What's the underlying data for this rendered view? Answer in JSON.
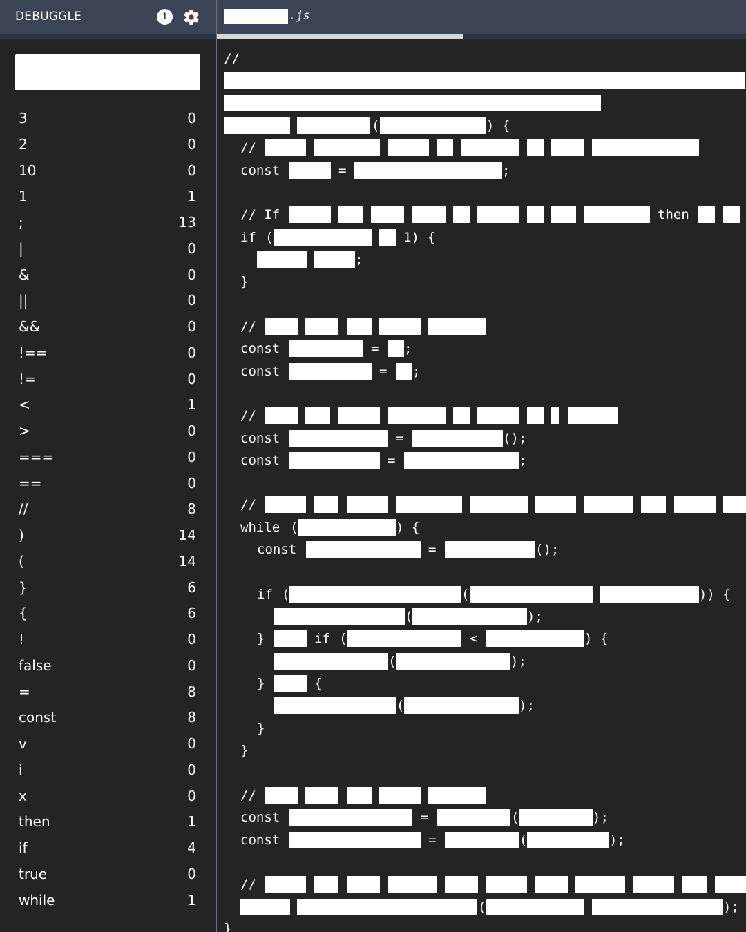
{
  "app": {
    "title": "DEBUGGLE"
  },
  "icons": {
    "info": "info-icon",
    "settings": "gear-icon",
    "info_glyph": "i"
  },
  "search": {
    "value": ""
  },
  "token_counts": [
    {
      "token": "3",
      "count": "0"
    },
    {
      "token": "2",
      "count": "0"
    },
    {
      "token": "10",
      "count": "0"
    },
    {
      "token": "1",
      "count": "1"
    },
    {
      "token": ";",
      "count": "13"
    },
    {
      "token": "|",
      "count": "0"
    },
    {
      "token": "&",
      "count": "0"
    },
    {
      "token": "||",
      "count": "0"
    },
    {
      "token": "&&",
      "count": "0"
    },
    {
      "token": "!==",
      "count": "0"
    },
    {
      "token": "!=",
      "count": "0"
    },
    {
      "token": "<",
      "count": "1"
    },
    {
      "token": ">",
      "count": "0"
    },
    {
      "token": "===",
      "count": "0"
    },
    {
      "token": "==",
      "count": "0"
    },
    {
      "token": "//",
      "count": "8"
    },
    {
      "token": ")",
      "count": "14"
    },
    {
      "token": "(",
      "count": "14"
    },
    {
      "token": "}",
      "count": "6"
    },
    {
      "token": "{",
      "count": "6"
    },
    {
      "token": "!",
      "count": "0"
    },
    {
      "token": "false",
      "count": "0"
    },
    {
      "token": "=",
      "count": "8"
    },
    {
      "token": "const",
      "count": "8"
    },
    {
      "token": "v",
      "count": "0"
    },
    {
      "token": "i",
      "count": "0"
    },
    {
      "token": "x",
      "count": "0"
    },
    {
      "token": "then",
      "count": "1"
    },
    {
      "token": "if",
      "count": "4"
    },
    {
      "token": "true",
      "count": "0"
    },
    {
      "token": "while",
      "count": "1"
    }
  ],
  "editor": {
    "file_extension": ".js",
    "progress": 0.465,
    "code_tokens": {
      "comment": "//",
      "const": "const",
      "if": "if",
      "while": "while",
      "then": "then",
      "if_comment": "// If",
      "one_paren": "1)",
      "open_brace": "{",
      "close_brace": "}",
      "open_paren": "(",
      "close_paren_brace": ") {",
      "close_dparen_brace": ")) {",
      "close_semi": ");",
      "call_semi": "();",
      "semi": ";",
      "eq": "=",
      "lt": "<"
    }
  }
}
